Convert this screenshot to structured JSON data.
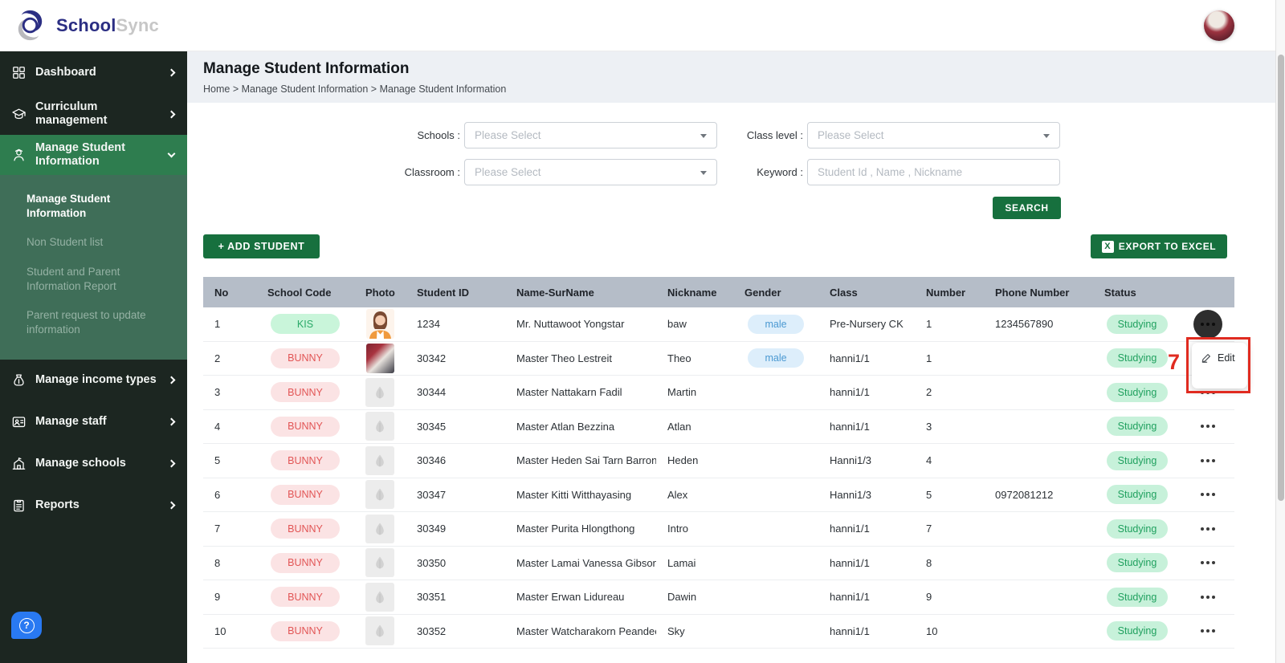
{
  "brand": {
    "name_primary": "School",
    "name_secondary": "Sync"
  },
  "sidebar": {
    "items": [
      {
        "label": "Dashboard",
        "icon": "dashboard-icon",
        "state": "collapsed",
        "active": false
      },
      {
        "label": "Curriculum management",
        "icon": "curriculum-icon",
        "state": "collapsed",
        "active": false
      },
      {
        "label": "Manage Student Information",
        "icon": "student-info-icon",
        "state": "expanded",
        "active": true
      },
      {
        "label": "Manage income types",
        "icon": "income-types-icon",
        "state": "collapsed",
        "active": false
      },
      {
        "label": "Manage staff",
        "icon": "staff-icon",
        "state": "collapsed",
        "active": false
      },
      {
        "label": "Manage schools",
        "icon": "schools-icon",
        "state": "collapsed",
        "active": false
      },
      {
        "label": "Reports",
        "icon": "reports-icon",
        "state": "collapsed",
        "active": false
      }
    ],
    "submenu": [
      {
        "label": "Manage Student Information",
        "active": true
      },
      {
        "label": "Non Student list",
        "active": false
      },
      {
        "label": "Student and Parent Information Report",
        "active": false
      },
      {
        "label": "Parent request to update information",
        "active": false
      }
    ]
  },
  "page": {
    "title": "Manage Student Information",
    "breadcrumb": "Home > Manage Student Information > Manage Student Information"
  },
  "filters": {
    "schools_label": "Schools :",
    "classroom_label": "Classroom :",
    "class_level_label": "Class level :",
    "keyword_label": "Keyword :",
    "schools_value": "Please Select",
    "classroom_value": "Please Select",
    "class_level_value": "Please Select",
    "keyword_placeholder": "Student Id , Name , Nickname",
    "search_label": "SEARCH"
  },
  "toolbar": {
    "add_student_label": "+ ADD STUDENT",
    "export_label": "EXPORT TO EXCEL",
    "export_icon_label": "X"
  },
  "table": {
    "headers": [
      "No",
      "School Code",
      "Photo",
      "Student ID",
      "Name-SurName",
      "Nickname",
      "Gender",
      "Class",
      "Number",
      "Phone Number",
      "Status"
    ],
    "rows": [
      {
        "no": "1",
        "school_code": "KIS",
        "school_code_style": "green",
        "photo": "woman-cartoon",
        "student_id": "1234",
        "name": "Mr. Nuttawoot Yongstar",
        "nickname": "baw",
        "gender": "male",
        "class": "Pre-Nursery CK",
        "number": "1",
        "phone": "1234567890",
        "status": "Studying",
        "menu_open": true
      },
      {
        "no": "2",
        "school_code": "BUNNY",
        "school_code_style": "red",
        "photo": "anime-photo",
        "student_id": "30342",
        "name": "Master Theo Lestreit",
        "nickname": "Theo",
        "gender": "male",
        "class": "hanni1/1",
        "number": "1",
        "phone": "",
        "status": "Studying",
        "menu_open": false
      },
      {
        "no": "3",
        "school_code": "BUNNY",
        "school_code_style": "red",
        "photo": "placeholder",
        "student_id": "30344",
        "name": "Master Nattakarn Fadil",
        "nickname": "Martin",
        "gender": "",
        "class": "hanni1/1",
        "number": "2",
        "phone": "",
        "status": "Studying",
        "menu_open": false
      },
      {
        "no": "4",
        "school_code": "BUNNY",
        "school_code_style": "red",
        "photo": "placeholder",
        "student_id": "30345",
        "name": "Master Atlan Bezzina",
        "nickname": "Atlan",
        "gender": "",
        "class": "hanni1/1",
        "number": "3",
        "phone": "",
        "status": "Studying",
        "menu_open": false
      },
      {
        "no": "5",
        "school_code": "BUNNY",
        "school_code_style": "red",
        "photo": "placeholder",
        "student_id": "30346",
        "name": "Master Heden Sai Tarn Barron",
        "nickname": "Heden",
        "gender": "",
        "class": "Hanni1/3",
        "number": "4",
        "phone": "",
        "status": "Studying",
        "menu_open": false
      },
      {
        "no": "6",
        "school_code": "BUNNY",
        "school_code_style": "red",
        "photo": "placeholder",
        "student_id": "30347",
        "name": "Master Kitti Witthayasing",
        "nickname": "Alex",
        "gender": "",
        "class": "Hanni1/3",
        "number": "5",
        "phone": "0972081212",
        "status": "Studying",
        "menu_open": false
      },
      {
        "no": "7",
        "school_code": "BUNNY",
        "school_code_style": "red",
        "photo": "placeholder",
        "student_id": "30349",
        "name": "Master Purita Hlongthong",
        "nickname": "Intro",
        "gender": "",
        "class": "hanni1/1",
        "number": "7",
        "phone": "",
        "status": "Studying",
        "menu_open": false
      },
      {
        "no": "8",
        "school_code": "BUNNY",
        "school_code_style": "red",
        "photo": "placeholder",
        "student_id": "30350",
        "name": "Master Lamai Vanessa Gibson",
        "nickname": "Lamai",
        "gender": "",
        "class": "hanni1/1",
        "number": "8",
        "phone": "",
        "status": "Studying",
        "menu_open": false
      },
      {
        "no": "9",
        "school_code": "BUNNY",
        "school_code_style": "red",
        "photo": "placeholder",
        "student_id": "30351",
        "name": "Master Erwan Lidureau",
        "nickname": "Dawin",
        "gender": "",
        "class": "hanni1/1",
        "number": "9",
        "phone": "",
        "status": "Studying",
        "menu_open": false
      },
      {
        "no": "10",
        "school_code": "BUNNY",
        "school_code_style": "red",
        "photo": "placeholder",
        "student_id": "30352",
        "name": "Master Watcharakorn Peandee",
        "nickname": "Sky",
        "gender": "",
        "class": "hanni1/1",
        "number": "10",
        "phone": "",
        "status": "Studying",
        "menu_open": false
      }
    ]
  },
  "action_menu": {
    "edit_label": "Edit"
  },
  "annotation": {
    "step_number": "7",
    "color": "#e02b20"
  },
  "colors": {
    "sidebar_bg": "#1c2621",
    "sidebar_active_green": "#2e7d4f",
    "submenu_bg": "#3f6e58",
    "button_green": "#17703e",
    "table_header_bg": "#b5bdc8",
    "school_code_green_bg": "#c9f5da",
    "school_code_green_text": "#2aa968",
    "school_code_red_bg": "#fbe3e4",
    "school_code_red_text": "#e25555",
    "gender_blue_bg": "#ddeefb",
    "gender_blue_text": "#4b99d2",
    "status_green_bg": "#c7f1da",
    "status_green_text": "#1fa05e",
    "help_button_blue": "#2979f2",
    "logo_navy": "#2b2e83",
    "annotation_red": "#e02b20"
  }
}
